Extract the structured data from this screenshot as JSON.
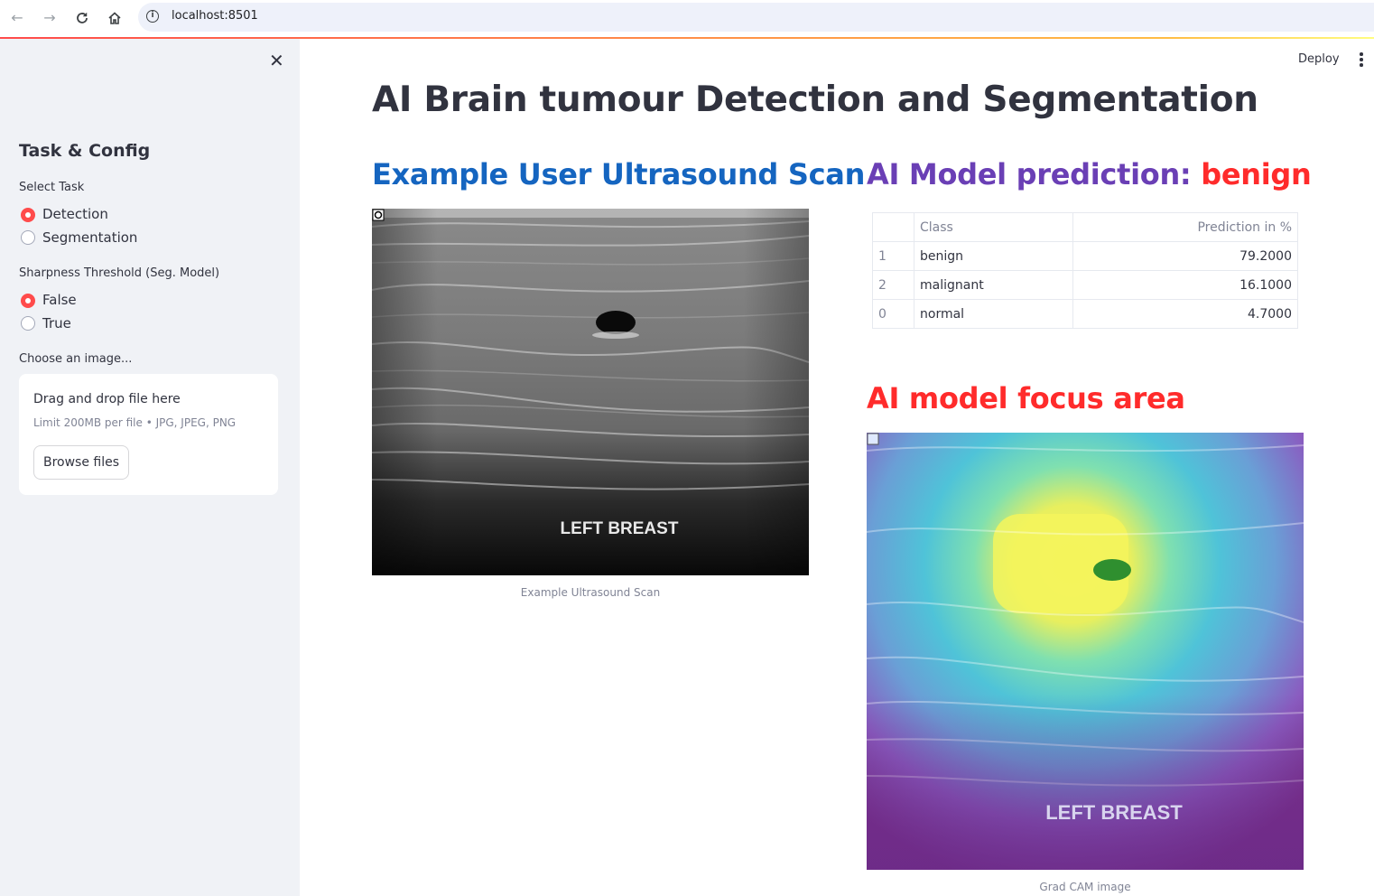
{
  "browser": {
    "url": "localhost:8501"
  },
  "sidebar": {
    "title": "Task & Config",
    "task_label": "Select Task",
    "task_options": [
      "Detection",
      "Segmentation"
    ],
    "task_selected": "Detection",
    "sharpness_label": "Sharpness Threshold (Seg. Model)",
    "sharpness_options": [
      "False",
      "True"
    ],
    "sharpness_selected": "False",
    "upload_label": "Choose an image...",
    "upload": {
      "drag_text": "Drag and drop file here",
      "limit_text": "Limit 200MB per file • JPG, JPEG, PNG",
      "browse_label": "Browse files"
    }
  },
  "header": {
    "deploy_label": "Deploy"
  },
  "main": {
    "title": "AI Brain tumour Detection and Segmentation",
    "left": {
      "heading": "Example User Ultrasound Scan",
      "image_text": "LEFT BREAST",
      "caption": "Example Ultrasound Scan"
    },
    "right": {
      "prediction_prefix": "AI Model prediction: ",
      "prediction_value": "benign",
      "table": {
        "columns": [
          "",
          "Class",
          "Prediction in %"
        ],
        "rows": [
          {
            "index": "1",
            "class": "benign",
            "value": "79.2000"
          },
          {
            "index": "2",
            "class": "malignant",
            "value": "16.1000"
          },
          {
            "index": "0",
            "class": "normal",
            "value": "4.7000"
          }
        ]
      },
      "focus_heading": "AI model focus area",
      "cam_image_text": "LEFT BREAST",
      "cam_caption": "Grad CAM image"
    }
  },
  "colors": {
    "accent": "#ff4b4b",
    "heading_blue": "#1565c0",
    "heading_purple": "#6a3fb5",
    "heading_red": "#ff2b2b",
    "sidebar_bg": "#f0f2f6"
  }
}
